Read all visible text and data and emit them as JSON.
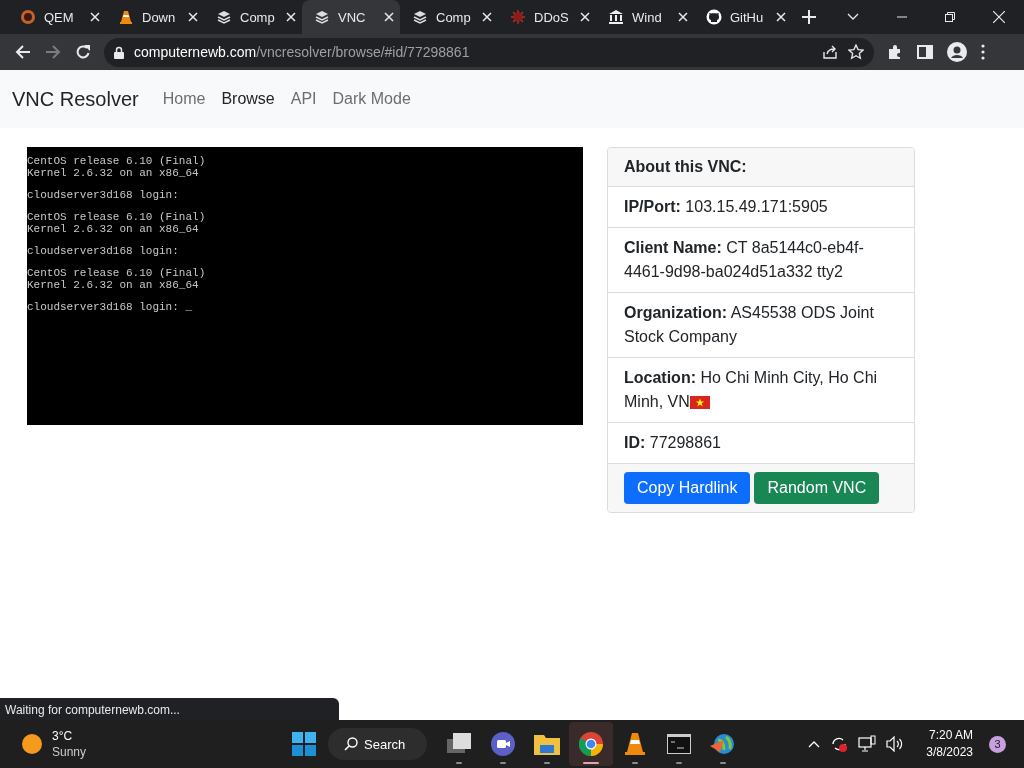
{
  "browser": {
    "tabs": [
      {
        "label": "QEM",
        "kind": "qemu",
        "selected": false
      },
      {
        "label": "Down",
        "kind": "cone",
        "selected": false
      },
      {
        "label": "Comp",
        "kind": "site",
        "selected": false
      },
      {
        "label": "VNC",
        "kind": "site",
        "selected": true
      },
      {
        "label": "Comp",
        "kind": "site",
        "selected": false
      },
      {
        "label": "DDoS",
        "kind": "virus",
        "selected": false
      },
      {
        "label": "Wind",
        "kind": "bank",
        "selected": false
      },
      {
        "label": "GitHu",
        "kind": "github",
        "selected": false
      }
    ],
    "address": {
      "domain": "computernewb.com",
      "path": "/vncresolver/browse/#id/77298861"
    }
  },
  "page": {
    "brand": "VNC Resolver",
    "nav": [
      {
        "label": "Home",
        "selected": false
      },
      {
        "label": "Browse",
        "selected": true
      },
      {
        "label": "API",
        "selected": false
      },
      {
        "label": "Dark Mode",
        "selected": false
      }
    ],
    "terminal": {
      "blocks": [
        [
          "CentOS release 6.10 (Final)",
          "Kernel 2.6.32 on an x86_64"
        ],
        [
          "cloudserver3d168 login:"
        ],
        [
          "CentOS release 6.10 (Final)",
          "Kernel 2.6.32 on an x86_64"
        ],
        [
          "cloudserver3d168 login:"
        ],
        [
          "CentOS release 6.10 (Final)",
          "Kernel 2.6.32 on an x86_64"
        ],
        [
          "cloudserver3d168 login: _"
        ]
      ]
    },
    "card": {
      "header": "About this VNC:",
      "fields": [
        {
          "label": "IP/Port:",
          "value": "103.15.49.171:5905"
        },
        {
          "label": "Client Name:",
          "value": "CT 8a5144c0-eb4f-4461-9d98-ba024d51a332 tty2"
        },
        {
          "label": "Organization:",
          "value": "AS45538 ODS Joint Stock Company"
        },
        {
          "label": "Location:",
          "value": "Ho Chi Minh City, Ho Chi Minh, VN",
          "flag": true
        },
        {
          "label": "ID:",
          "value": "77298861"
        }
      ],
      "buttons": [
        {
          "label": "Copy Hardlink",
          "kind": "primary"
        },
        {
          "label": "Random VNC",
          "kind": "success"
        }
      ]
    }
  },
  "status_bubble": "Waiting for computernewb.com...",
  "taskbar": {
    "weather": {
      "temp": "3°C",
      "condition": "Sunny"
    },
    "search": "Search",
    "apps": [
      {
        "kind": "gallery",
        "selected": false
      },
      {
        "kind": "camera",
        "selected": false
      },
      {
        "kind": "folder",
        "selected": false
      },
      {
        "kind": "chrome",
        "selected": true
      },
      {
        "kind": "cone",
        "selected": false
      },
      {
        "kind": "terminal",
        "selected": false
      },
      {
        "kind": "globe",
        "selected": false
      }
    ],
    "time": "7:20 AM",
    "date": "3/8/2023",
    "notifications": "3"
  }
}
